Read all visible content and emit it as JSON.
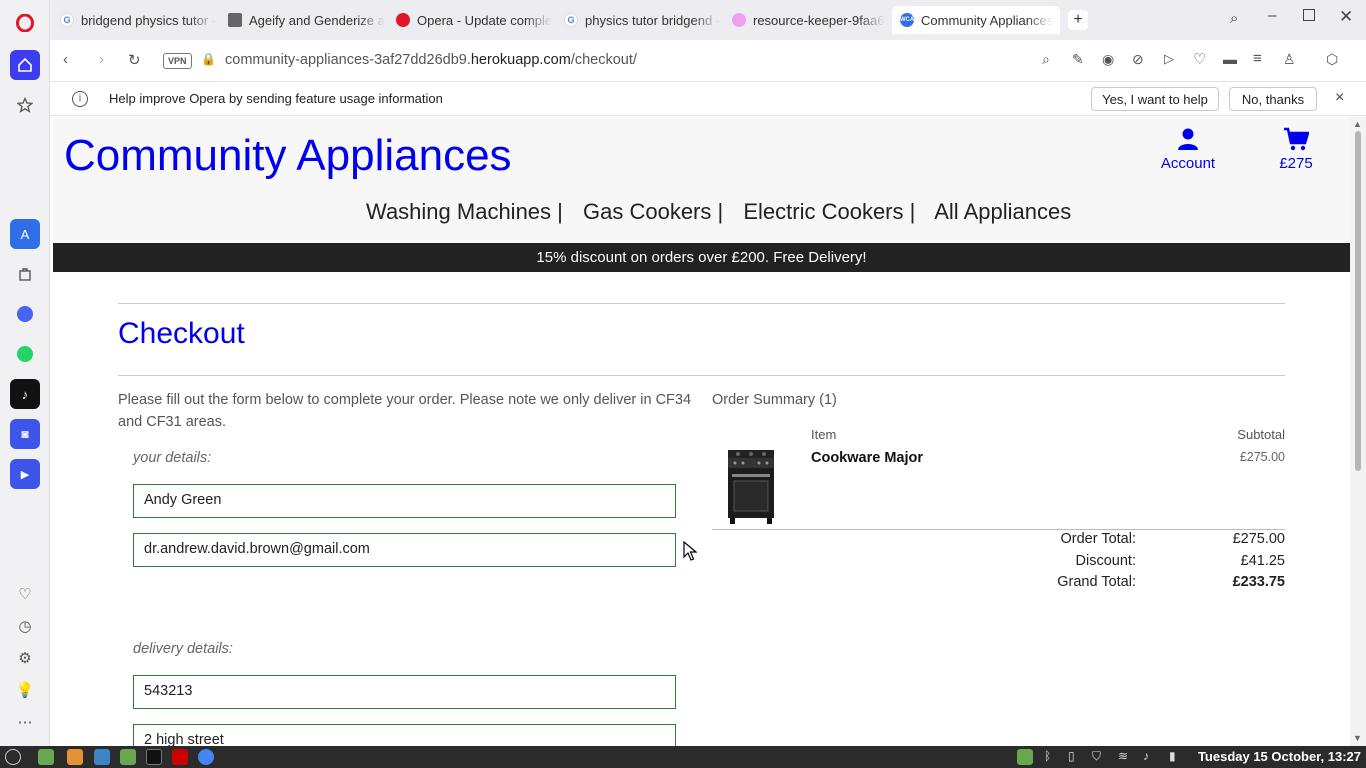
{
  "browser": {
    "tabs": [
      {
        "title": "bridgend physics tutor -",
        "favicon": "google",
        "active": false
      },
      {
        "title": "Ageify and Genderize a",
        "favicon": "document",
        "active": false
      },
      {
        "title": "Opera - Update comple",
        "favicon": "opera",
        "active": false
      },
      {
        "title": "physics tutor bridgend -",
        "favicon": "google",
        "active": false
      },
      {
        "title": "resource-keeper-9faa6",
        "favicon": "pink-circle",
        "active": false
      },
      {
        "title": "Community Appliances",
        "favicon": "ca",
        "active": true
      }
    ],
    "vpn_badge": "VPN",
    "url_host": "community-appliances-3af27dd26db9.",
    "url_domain": "herokuapp.com",
    "url_path": "/checkout/",
    "favicon_ca_text": "WCA"
  },
  "infobar": {
    "message": "Help improve Opera by sending feature usage information",
    "accept_label": "Yes, I want to help",
    "decline_label": "No, thanks",
    "close_glyph": "×"
  },
  "site": {
    "brand": "Community Appliances",
    "account_label": "Account",
    "bag_total": "£275",
    "nav": [
      "Washing Machines |",
      "Gas Cookers |",
      "Electric Cookers |",
      "All Appliances"
    ],
    "banner": "15% discount on orders over £200. Free Delivery!"
  },
  "checkout": {
    "title": "Checkout",
    "intro": "Please fill out the form below to complete your order. Please note we only deliver in CF34 and CF31 areas.",
    "your_details_label": "your details:",
    "full_name": "Andy Green",
    "email": "dr.andrew.david.brown@gmail.com",
    "delivery_details_label": "delivery details:",
    "phone": "543213",
    "street": "2 high street"
  },
  "summary": {
    "heading": "Order Summary (1)",
    "col_item": "Item",
    "col_subtotal": "Subtotal",
    "item_name": "Cookware Major",
    "item_subtotal": "£275.00",
    "order_total_label": "Order Total:",
    "order_total": "£275.00",
    "discount_label": "Discount:",
    "discount": "£41.25",
    "grand_total_label": "Grand Total:",
    "grand_total": "£233.75"
  },
  "taskbar": {
    "clock": "Tuesday 15 October, 13:27"
  },
  "colors": {
    "link_blue": "#0000ee",
    "banner_bg": "#222222",
    "field_border": "#2e7d32"
  }
}
